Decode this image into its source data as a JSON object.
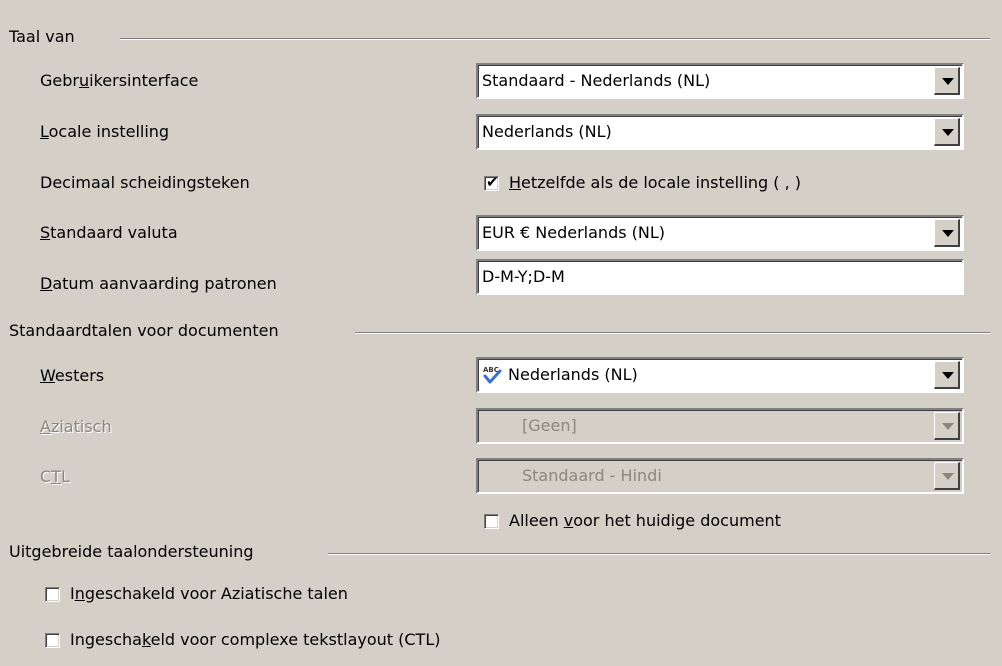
{
  "sections": {
    "taal_van": "Taal van",
    "standaardtalen": "Standaardtalen voor documenten",
    "uitgebreide": "Uitgebreide taalondersteuning"
  },
  "fields": {
    "gebruikersinterface": {
      "label_pre": "Gebr",
      "label_acc": "u",
      "label_post": "ikersinterface",
      "value": "Standaard - Nederlands (NL)"
    },
    "locale": {
      "label_acc": "L",
      "label_post": "ocale instelling",
      "value": "Nederlands (NL)"
    },
    "decimaal": {
      "label": "Decimaal scheidingsteken",
      "check_acc": "H",
      "check_post": "etzelfde als de locale instelling ( , )",
      "checked": true
    },
    "valuta": {
      "label_acc": "S",
      "label_post": "tandaard valuta",
      "value": "EUR  € Nederlands (NL)"
    },
    "datum": {
      "label_acc": "D",
      "label_post": "atum aanvaarding  patronen",
      "value": "D-M-Y;D-M"
    },
    "westers": {
      "label_acc": "W",
      "label_post": "esters",
      "value": "Nederlands (NL)",
      "icon": "spellcheck-icon"
    },
    "aziatisch": {
      "label_acc": "A",
      "label_post": "ziatisch",
      "value": "[Geen]",
      "disabled": true
    },
    "ctl": {
      "label_pre": "C",
      "label_acc": "T",
      "label_post": "L",
      "value": "Standaard - Hindi",
      "disabled": true
    },
    "alleen": {
      "pre": "Alleen ",
      "acc": "v",
      "post": "oor het huidige document",
      "checked": false
    }
  },
  "extended": {
    "aziatische": {
      "pre": "I",
      "acc": "n",
      "post": "geschakeld voor Aziatische talen",
      "checked": false
    },
    "complexe": {
      "pre": "Ingescha",
      "acc": "k",
      "post": "eld voor complexe tekstlayout (CTL)",
      "checked": false
    }
  }
}
